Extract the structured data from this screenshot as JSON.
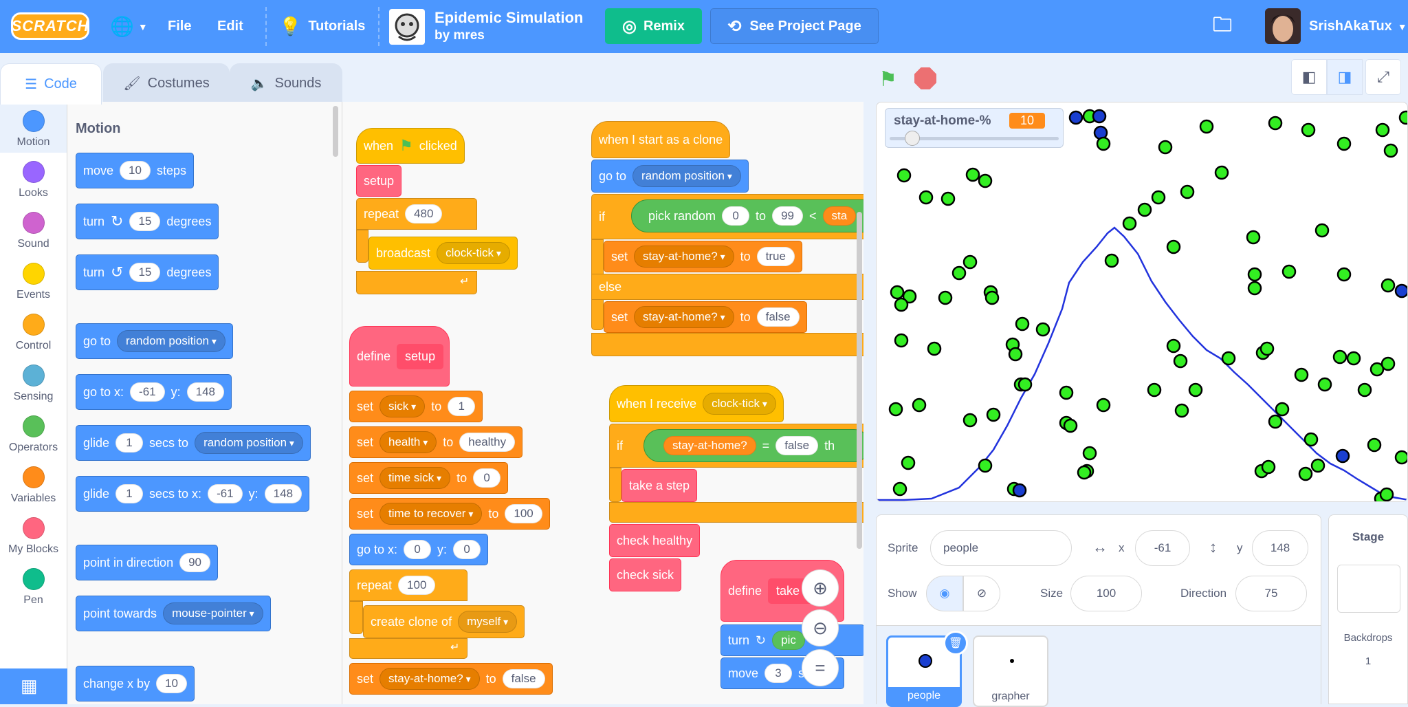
{
  "header": {
    "logo": "SCRATCH",
    "file": "File",
    "edit": "Edit",
    "tutorials": "Tutorials",
    "project_title": "Epidemic Simulation",
    "project_author": "by mres",
    "remix": "Remix",
    "see_project": "See Project Page",
    "username": "SrishAkaTux"
  },
  "tabs": [
    "Code",
    "Costumes",
    "Sounds"
  ],
  "categories": [
    {
      "label": "Motion",
      "color": "#4c97ff"
    },
    {
      "label": "Looks",
      "color": "#9966ff"
    },
    {
      "label": "Sound",
      "color": "#cf63cf"
    },
    {
      "label": "Events",
      "color": "#ffd500"
    },
    {
      "label": "Control",
      "color": "#ffab19"
    },
    {
      "label": "Sensing",
      "color": "#5cb1d6"
    },
    {
      "label": "Operators",
      "color": "#59c059"
    },
    {
      "label": "Variables",
      "color": "#ff8c1a"
    },
    {
      "label": "My Blocks",
      "color": "#ff6680"
    },
    {
      "label": "Pen",
      "color": "#0fbd8c"
    }
  ],
  "palette": {
    "heading": "Motion",
    "move": [
      "move",
      "10",
      "steps"
    ],
    "turn_right": [
      "turn",
      "15",
      "degrees"
    ],
    "turn_left": [
      "turn",
      "15",
      "degrees"
    ],
    "goto": [
      "go to",
      "random position"
    ],
    "gotoxy": [
      "go to x:",
      "-61",
      "y:",
      "148"
    ],
    "glide": [
      "glide",
      "1",
      "secs to",
      "random position"
    ],
    "glidexy": [
      "glide",
      "1",
      "secs to x:",
      "-61",
      "y:",
      "148"
    ],
    "point_dir": [
      "point in direction",
      "90"
    ],
    "point_towards": [
      "point towards",
      "mouse-pointer"
    ],
    "change_x": [
      "change x by",
      "10"
    ]
  },
  "scripts": {
    "when_flag": [
      "when",
      "clicked"
    ],
    "setup": "setup",
    "repeat480": [
      "repeat",
      "480"
    ],
    "broadcast": [
      "broadcast",
      "clock-tick"
    ],
    "define": "define",
    "set_sick": [
      "set",
      "sick",
      "to",
      "1"
    ],
    "set_health": [
      "set",
      "health",
      "to",
      "healthy"
    ],
    "set_time_sick": [
      "set",
      "time sick",
      "to",
      "0"
    ],
    "set_recover": [
      "set",
      "time to recover",
      "to",
      "100"
    ],
    "goto00": [
      "go to x:",
      "0",
      "y:",
      "0"
    ],
    "repeat100": [
      "repeat",
      "100"
    ],
    "create_clone": [
      "create clone of",
      "myself"
    ],
    "set_stay": [
      "set",
      "stay-at-home?",
      "to",
      "false"
    ],
    "clone_hat": "when I start as a clone",
    "clone_goto": [
      "go to",
      "random position"
    ],
    "if": "if",
    "pick_random": [
      "pick random",
      "0",
      "to",
      "99",
      "<",
      "sta"
    ],
    "set_true": [
      "set",
      "stay-at-home?",
      "to",
      "true"
    ],
    "else": "else",
    "set_false": [
      "set",
      "stay-at-home?",
      "to",
      "false"
    ],
    "receive": [
      "when I receive",
      "clock-tick"
    ],
    "if2": "if",
    "eq": [
      "stay-at-home?",
      "=",
      "false",
      "th"
    ],
    "take_step": "take a step",
    "check_healthy": "check healthy",
    "check_sick": "check sick",
    "define2": [
      "define",
      "take a"
    ],
    "turn2": [
      "turn",
      "pic",
      "om"
    ],
    "move2": [
      "move",
      "3",
      "st"
    ]
  },
  "stage": {
    "monitor_label": "stay-at-home-%",
    "monitor_value": "10",
    "slider_fraction": 0.1
  },
  "sprite_info": {
    "sprite_label": "Sprite",
    "sprite_name": "people",
    "x_label": "x",
    "x": "-61",
    "y_label": "y",
    "y": "148",
    "show_label": "Show",
    "size_label": "Size",
    "size": "100",
    "direction_label": "Direction",
    "direction": "75"
  },
  "sprites": [
    "people",
    "grapher"
  ],
  "stage_pane": {
    "title": "Stage",
    "backdrops_label": "Backdrops",
    "backdrops_count": "1"
  }
}
